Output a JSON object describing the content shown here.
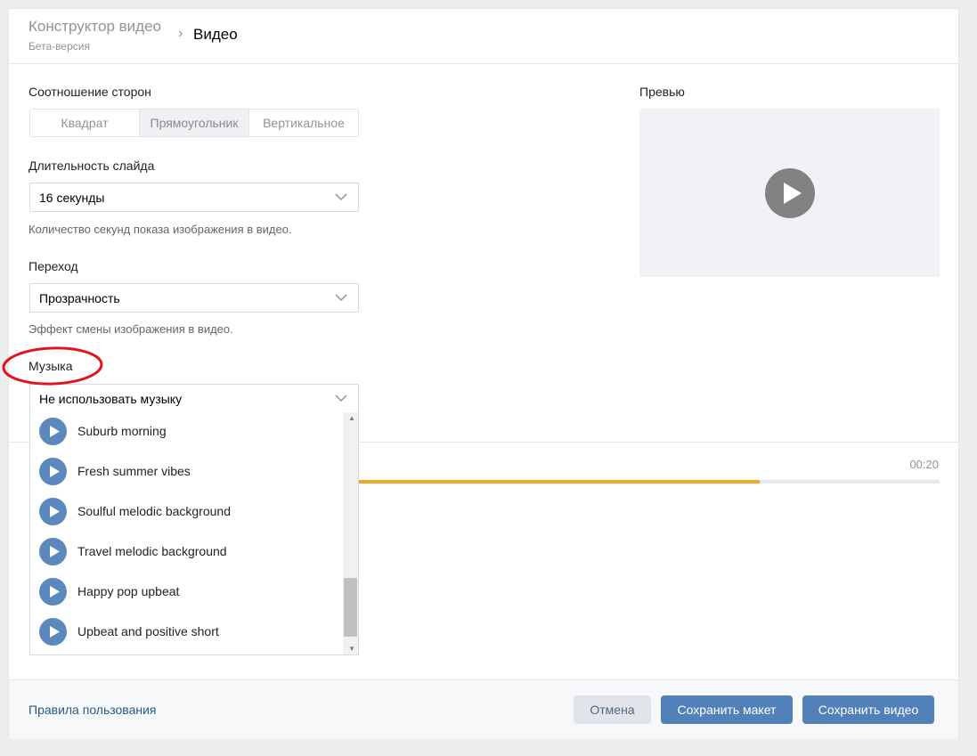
{
  "header": {
    "title": "Конструктор видео",
    "subtitle": "Бета-версия",
    "separator": "›",
    "current": "Видео"
  },
  "aspect": {
    "label": "Соотношение сторон",
    "options": [
      "Квадрат",
      "Прямоугольник",
      "Вертикальное"
    ],
    "selected": "Прямоугольник"
  },
  "duration": {
    "label": "Длительность слайда",
    "value": "16 секунды",
    "hint": "Количество секунд показа изображения в видео."
  },
  "transition": {
    "label": "Переход",
    "value": "Прозрачность",
    "hint": "Эффект смены изображения в видео."
  },
  "music": {
    "label": "Музыка",
    "value": "Не использовать музыку",
    "tracks": [
      "Suburb morning",
      "Fresh summer vibes",
      "Soulful melodic background",
      "Travel melodic background",
      "Happy pop upbeat",
      "Upbeat and positive short"
    ]
  },
  "preview": {
    "label": "Превью"
  },
  "timeline": {
    "time": "00:20",
    "progress": 0.69
  },
  "footer": {
    "rules": "Правила пользования",
    "cancel": "Отмена",
    "save_layout": "Сохранить макет",
    "save_video": "Сохранить видео"
  },
  "colors": {
    "accent": "#5181b8",
    "progress": "#f4a628",
    "annotation": "#e0161e"
  }
}
